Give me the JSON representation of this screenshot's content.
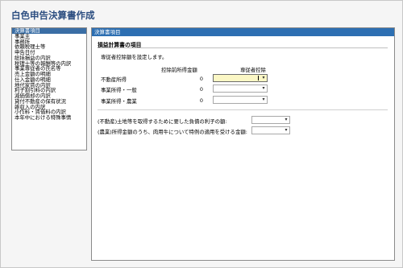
{
  "app": {
    "title": "白色申告決算書作成"
  },
  "nav": {
    "items": [
      "決算書項目",
      "事業主",
      "事務所",
      "依頼税理士等",
      "申告日付",
      "総括損益の内訳",
      "税理士等の報酬等の内訳",
      "事業専従者の氏名等",
      "売上金額の明細",
      "仕入金額の明細",
      "地代家賃の内訳",
      "利子割引料の内訳",
      "減価償却の内訳",
      "貸付不動産の保有状況",
      "雑収入の内訳",
      "小作料・賃借料の内訳",
      "本年中における特殊事情"
    ],
    "selected_index": 0
  },
  "panel": {
    "header": "決算書項目",
    "section_title": "損益計算書の項目",
    "description": "専従者控除額を設定します。",
    "col_deduction": "控除前所得金額",
    "col_employee": "専従者控除",
    "rows": [
      {
        "label": "不動産所得",
        "value": "0"
      },
      {
        "label": "事業所得・一般",
        "value": "0"
      },
      {
        "label": "事業所得・農業",
        "value": "0"
      }
    ],
    "interest_questions": [
      "(不動産)土地等を取得するために要した負債の利子の額:",
      "(農業)所得金額のうち、肉用牛について特例の適用を受ける金額:"
    ]
  },
  "colors": {
    "title": "#2b4d80",
    "header_bg": "#2d6fb2",
    "selected_bg": "#3a6ea5",
    "active_field_bg": "#fbf7c5"
  },
  "icons": {
    "dropdown": "chevron-down-icon"
  }
}
